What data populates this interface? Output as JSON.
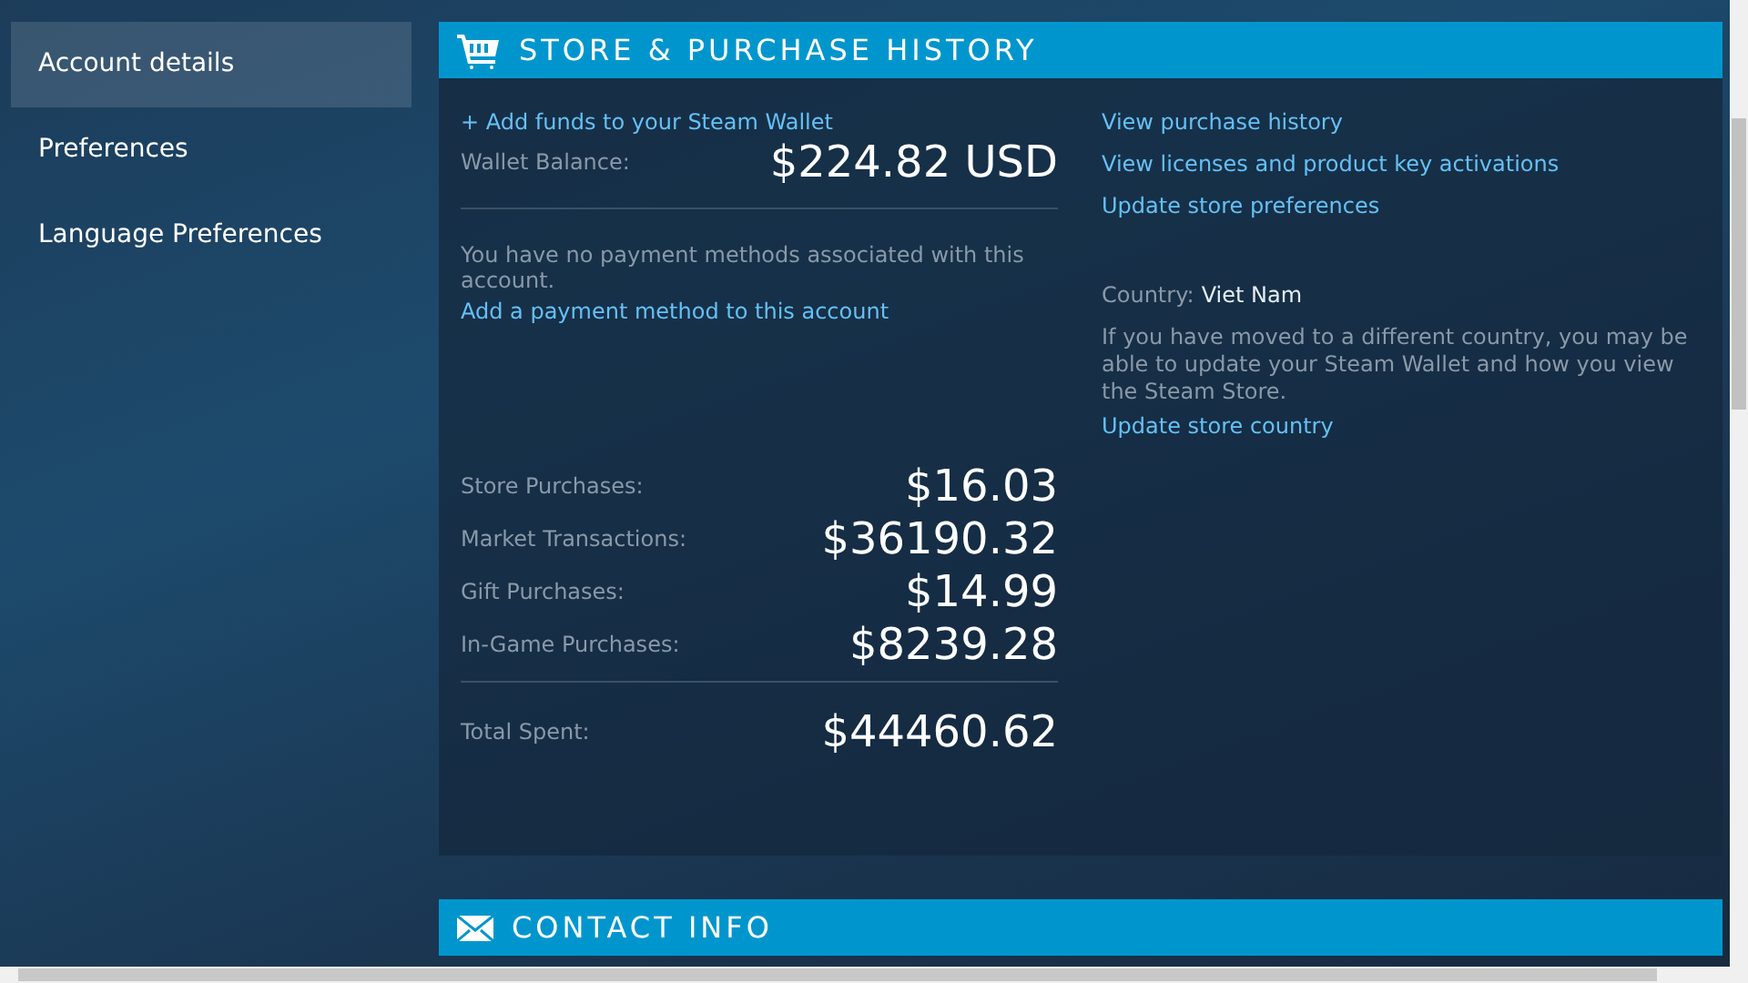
{
  "sidebar": {
    "items": [
      {
        "label": "Account details",
        "selected": true
      },
      {
        "label": "Preferences",
        "selected": false
      },
      {
        "label": "Language Preferences",
        "selected": false
      }
    ]
  },
  "store_section": {
    "title": "STORE & PURCHASE HISTORY",
    "add_funds_link": "+ Add funds to your Steam Wallet",
    "wallet": {
      "label": "Wallet Balance:",
      "value": "$224.82 USD"
    },
    "no_payment_text": "You have no payment methods associated with this account.",
    "add_payment_link": "Add a payment method to this account",
    "purchases": [
      {
        "label": "Store Purchases:",
        "value": "$16.03"
      },
      {
        "label": "Market Transactions:",
        "value": "$36190.32"
      },
      {
        "label": "Gift Purchases:",
        "value": "$14.99"
      },
      {
        "label": "In-Game Purchases:",
        "value": "$8239.28"
      }
    ],
    "total": {
      "label": "Total Spent:",
      "value": "$44460.62"
    },
    "links": [
      "View purchase history",
      "View licenses and product key activations",
      "Update store preferences"
    ],
    "country": {
      "label": "Country:",
      "value": "Viet Nam"
    },
    "country_note": "If you have moved to a different country, you may be able to update your Steam Wallet and how you view the Steam Store.",
    "update_country_link": "Update store country"
  },
  "contact_section": {
    "title": "CONTACT INFO"
  }
}
